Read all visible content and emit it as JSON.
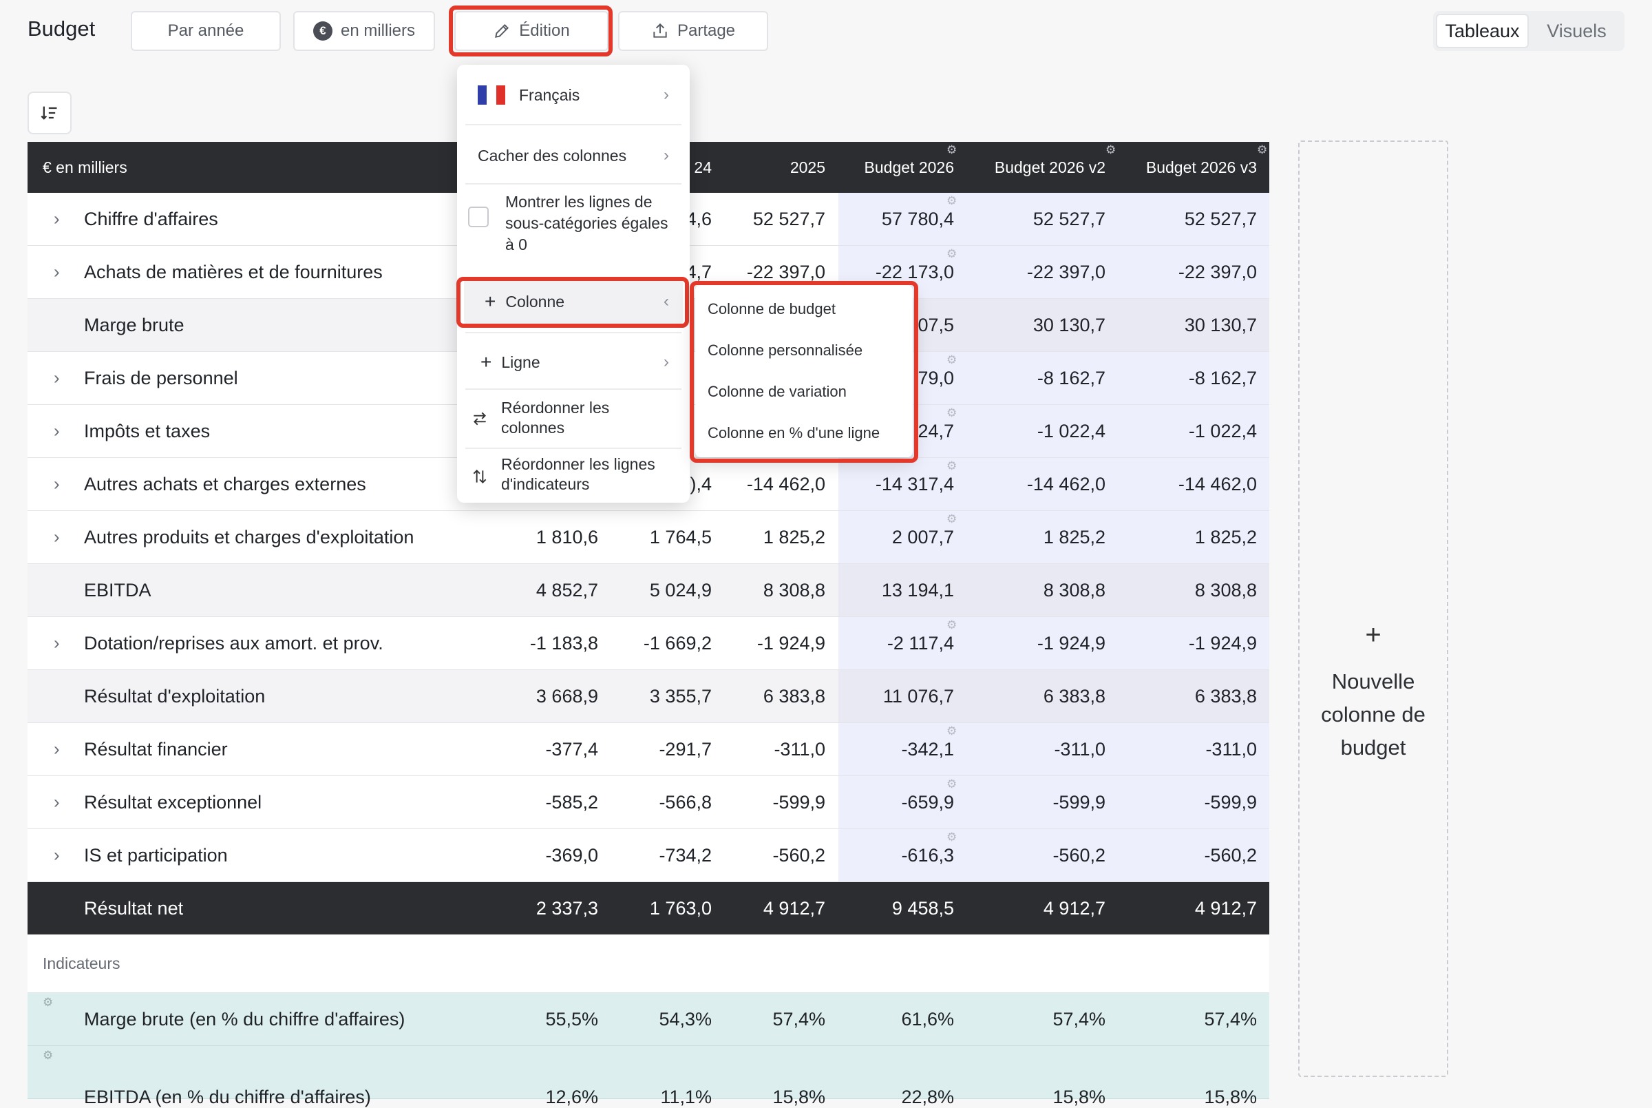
{
  "header": {
    "title": "Budget",
    "btn_year": "Par année",
    "btn_thousands": "en milliers",
    "btn_thousands_icon": "€",
    "btn_edit": "Édition",
    "btn_share": "Partage",
    "view_tables": "Tableaux",
    "view_visuals": "Visuels"
  },
  "table": {
    "unit_label": "€ en milliers",
    "columns": [
      "",
      "24",
      "2025",
      "Budget 2026",
      "Budget 2026 v2",
      "Budget 2026 v3"
    ],
    "rows": [
      {
        "label": "Chiffre d'affaires",
        "v": [
          "",
          "",
          "4,6",
          "52 527,7",
          "57 780,4",
          "52 527,7",
          "52 527,7"
        ]
      },
      {
        "label": "Achats de matières et de fournitures",
        "v": [
          "",
          "",
          "4,7",
          "-22 397,0",
          "-22 173,0",
          "-22 397,0",
          "-22 397,0"
        ]
      },
      {
        "label": "Marge brute",
        "v": [
          "",
          "",
          "",
          "",
          "07,5",
          "30 130,7",
          "30 130,7"
        ]
      },
      {
        "label": "Frais de personnel",
        "v": [
          "",
          "",
          "",
          "",
          "79,0",
          "-8 162,7",
          "-8 162,7"
        ]
      },
      {
        "label": "Impôts et taxes",
        "v": [
          "",
          "",
          "",
          "",
          "24,7",
          "-1 022,4",
          "-1 022,4"
        ]
      },
      {
        "label": "Autres achats et charges externes",
        "v": [
          "",
          "",
          "),4",
          "-14 462,0",
          "-14 317,4",
          "-14 462,0",
          "-14 462,0"
        ]
      },
      {
        "label": "Autres produits et charges d'exploitation",
        "v": [
          "1 810,6",
          "1 764,5",
          "1 825,2",
          "2 007,7",
          "1 825,2",
          "1 825,2"
        ]
      },
      {
        "label": "EBITDA",
        "v": [
          "4 852,7",
          "5 024,9",
          "8 308,8",
          "13 194,1",
          "8 308,8",
          "8 308,8"
        ]
      },
      {
        "label": "Dotation/reprises aux amort. et prov.",
        "v": [
          "-1 183,8",
          "-1 669,2",
          "-1 924,9",
          "-2 117,4",
          "-1 924,9",
          "-1 924,9"
        ]
      },
      {
        "label": "Résultat d'exploitation",
        "v": [
          "3 668,9",
          "3 355,7",
          "6 383,8",
          "11 076,7",
          "6 383,8",
          "6 383,8"
        ]
      },
      {
        "label": "Résultat financier",
        "v": [
          "-377,4",
          "-291,7",
          "-311,0",
          "-342,1",
          "-311,0",
          "-311,0"
        ]
      },
      {
        "label": "Résultat exceptionnel",
        "v": [
          "-585,2",
          "-566,8",
          "-599,9",
          "-659,9",
          "-599,9",
          "-599,9"
        ]
      },
      {
        "label": "IS et participation",
        "v": [
          "-369,0",
          "-734,2",
          "-560,2",
          "-616,3",
          "-560,2",
          "-560,2"
        ]
      },
      {
        "label": "Résultat net",
        "v": [
          "2 337,3",
          "1 763,0",
          "4 912,7",
          "9 458,5",
          "4 912,7",
          "4 912,7"
        ]
      }
    ],
    "indicators_label": "Indicateurs",
    "indicators": [
      {
        "label": "Marge brute (en % du chiffre d'affaires)",
        "v": [
          "55,5%",
          "54,3%",
          "57,4%",
          "61,6%",
          "57,4%",
          "57,4%"
        ]
      },
      {
        "label": "EBITDA (en % du chiffre d'affaires)",
        "v": [
          "12,6%",
          "11,1%",
          "15,8%",
          "22,8%",
          "15,8%",
          "15,8%"
        ]
      }
    ]
  },
  "new_column": {
    "plus": "+",
    "line1": "Nouvelle",
    "line2": "colonne de",
    "line3": "budget"
  },
  "menu": {
    "language": "Français",
    "hide_columns": "Cacher des colonnes",
    "show_zero_l1": "Montrer les lignes de",
    "show_zero_l2": "sous-catégories égales",
    "show_zero_l3": "à 0",
    "column": "Colonne",
    "line": "Ligne",
    "reorder_cols_l1": "Réordonner les",
    "reorder_cols_l2": "colonnes",
    "reorder_rows_l1": "Réordonner les lignes",
    "reorder_rows_l2": "d'indicateurs"
  },
  "submenu": {
    "budget_column": "Colonne de budget",
    "custom_column": "Colonne personnalisée",
    "variation_column": "Colonne de variation",
    "percent_column": "Colonne en % d'une ligne"
  }
}
